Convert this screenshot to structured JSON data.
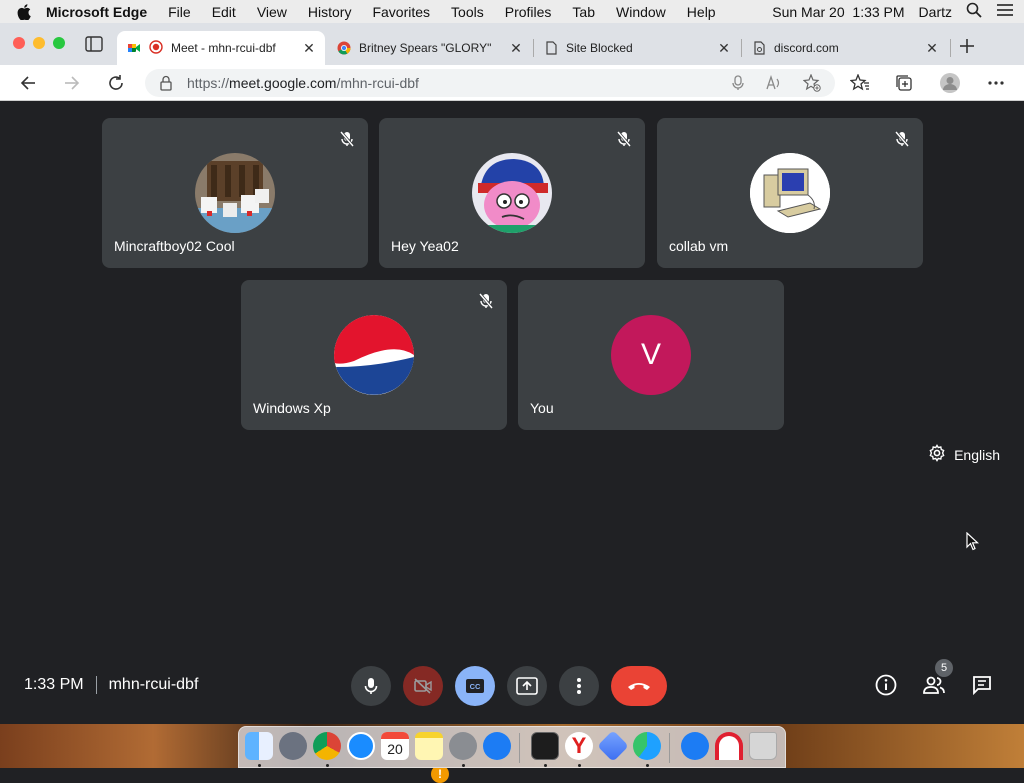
{
  "menubar": {
    "app_name": "Microsoft Edge",
    "menus": [
      "File",
      "Edit",
      "View",
      "History",
      "Favorites",
      "Tools",
      "Profiles",
      "Tab",
      "Window",
      "Help"
    ],
    "clock": "Sun Mar 20  1:33 PM",
    "user": "Dartz"
  },
  "tabs": [
    {
      "label": "Meet - mhn-rcui-dbf",
      "icon": "google-meet-icon",
      "active": true
    },
    {
      "label": "Britney Spears \"GLORY\"",
      "icon": "chrome-icon",
      "active": false
    },
    {
      "label": "Site Blocked",
      "icon": "page-icon",
      "active": false
    },
    {
      "label": "discord.com",
      "icon": "page-icon",
      "active": false
    }
  ],
  "address": {
    "url_prefix": "https://",
    "url_host": "meet.google.com",
    "url_path": "/mhn-rcui-dbf"
  },
  "participants": [
    {
      "name": "Mincraftboy02 Cool",
      "muted": true,
      "avatar": "minecraft-chickens-image"
    },
    {
      "name": "Hey Yea02",
      "muted": true,
      "avatar": "cartoon-character-image"
    },
    {
      "name": "collab vm",
      "muted": true,
      "avatar": "computer-image"
    },
    {
      "name": "Windows Xp",
      "muted": true,
      "avatar": "pepsi-logo-image"
    },
    {
      "name": "You",
      "muted": false,
      "avatar_letter": "V",
      "avatar_color": "#c2185b"
    }
  ],
  "caption_language": "English",
  "bottom": {
    "time": "1:33 PM",
    "meeting_code": "mhn-rcui-dbf",
    "camera_alert": "!",
    "participants_count": "5"
  },
  "colors": {
    "meet_bg": "#202124",
    "tile_bg": "#3c4043",
    "end_call": "#ea4335",
    "captions_active": "#8ab4f8",
    "camera_off": "#d93025",
    "you_avatar": "#c2185b"
  },
  "dock": {
    "calendar_day": "20",
    "apps": [
      "finder-icon",
      "launchpad-icon",
      "chrome-icon",
      "safari-icon",
      "calendar-icon",
      "notes-icon",
      "system-preferences-icon",
      "app-store-icon",
      "terminal-icon",
      "yandex-icon",
      "linear-icon",
      "edge-icon",
      "app-store-icon",
      "magnet-icon",
      "trash-icon"
    ]
  }
}
